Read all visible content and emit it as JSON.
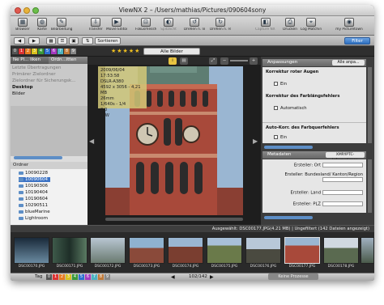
{
  "window": {
    "title": "ViewNX 2 – /Users/mathias/Pictures/090604sony"
  },
  "toolbar": {
    "items": [
      "Browser",
      "Karte",
      "Bearbeitung",
      "Transfer",
      "Movie Editor",
      "Fokusmessfeld",
      "Spitzlicht",
      "Drehen n. links",
      "Drehen n. rechts",
      "Capture NX 2",
      "Drucken",
      "Log Matching",
      "my Picturetown"
    ]
  },
  "bar2": {
    "sort_label": "Sortieren",
    "filter_label": "Filter"
  },
  "bar3": {
    "labels": [
      "0",
      "1",
      "2",
      "3",
      "4",
      "5",
      "6",
      "7",
      "8",
      "9"
    ],
    "rating_stars": "★★★★★",
    "selection": "Alle Bilder"
  },
  "left_panel": {
    "tabs": [
      "Ne Pl... liken",
      "Ordn...itten"
    ],
    "favorites": [
      "Letzte Übertragungen",
      "Primärer Zielordner",
      "Zielordner für Sicherungsk...",
      "Desktop",
      "Bilder"
    ],
    "folders_header": "Ordner",
    "folders": [
      "10090228",
      "10090604",
      "10190306",
      "10190404",
      "10190604",
      "10290511",
      "blueMarine",
      "Lightroom"
    ]
  },
  "info": {
    "lines": [
      "2009/06/04 17:53:58",
      "DSLR-A380",
      "4592 x 3056 - 4,21 MB",
      "26mm",
      "1/640s - 1/4",
      "0,0",
      "0LW"
    ]
  },
  "right_panel": {
    "adjust_header": "Anpassungen",
    "adjust_dropdown": "Alle anpa...",
    "red_eye_header": "Korrektur roter Augen",
    "red_eye_value": "Ein",
    "chroma_header": "Korrektur des Farblängsfehlers",
    "chroma_value": "Automatisch",
    "lateral_header": "Auto-Korr. des Farbquerfehlers",
    "lateral_value": "Ein",
    "meta_header": "Metadaten",
    "meta_dropdown": "XMP/IPTC-Informationen",
    "meta_fields": [
      "Ersteller: Ort",
      "Ersteller: Bundesland/ Kanton/Region",
      "Ersteller: Land",
      "Ersteller: PLZ"
    ]
  },
  "status": {
    "text": "Ausgewählt: DSC00177.JPG(4.21 MB) | Ungefiltert (142 Dateien angezeigt)"
  },
  "filmstrip": {
    "items": [
      "DSC00170.JPG",
      "DSC00171.JPG",
      "DSC00172.JPG",
      "DSC00173.JPG",
      "DSC00174.JPG",
      "DSC00175.JPG",
      "DSC00176.JPG",
      "DSC00177.JPG",
      "DSC00178.JPG",
      "DSC00179.JPG"
    ]
  },
  "bottom": {
    "tag_label": "Tag",
    "page": "102/142",
    "process": "Keine Prozesse"
  },
  "colors": {
    "label_colors": [
      "#555",
      "#d33",
      "#e77b1f",
      "#d9c21d",
      "#3a9a3a",
      "#2d6fd0",
      "#a43ac0",
      "#4cb3c2",
      "#c07a3a",
      "#888"
    ]
  }
}
